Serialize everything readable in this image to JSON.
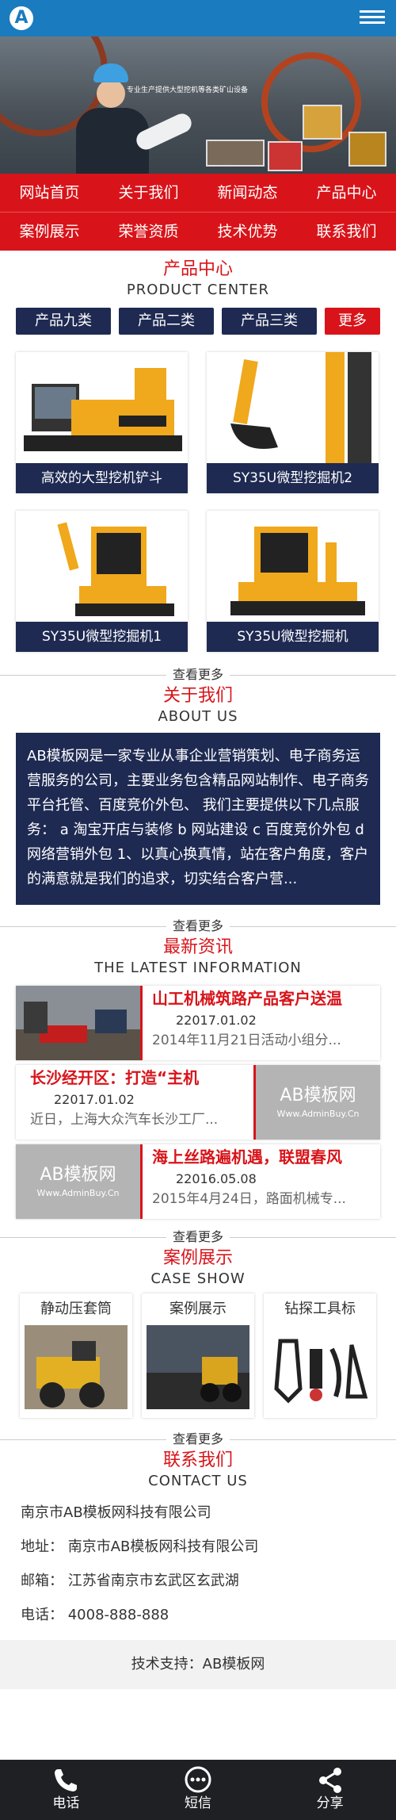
{
  "header": {
    "logo_letter": "A",
    "menu_icon": "hamburger-menu-icon"
  },
  "banner": {
    "tagline": "专业生产提供大型挖机等各类矿山设备"
  },
  "nav": {
    "row1": [
      "网站首页",
      "关于我们",
      "新闻动态",
      "产品中心"
    ],
    "row2": [
      "案例展示",
      "荣誉资质",
      "技术优势",
      "联系我们"
    ]
  },
  "products": {
    "title_cn": "产品中心",
    "title_en": "PRODUCT CENTER",
    "tabs": [
      "产品九类",
      "产品二类",
      "产品三类"
    ],
    "more_tab": "更多",
    "items": [
      "高效的大型挖机铲斗",
      "SY35U微型挖掘机2",
      "SY35U微型挖掘机1",
      "SY35U微型挖掘机"
    ],
    "more_link": "查看更多"
  },
  "about": {
    "title_cn": "关于我们",
    "title_en": "ABOUT US",
    "text": "AB模板网是一家专业从事企业营销策划、电子商务运营服务的公司，主要业务包含精品网站制作、电子商务平台托管、百度竞价外包、 我们主要提供以下几点服务： a 淘宝开店与装修 b 网站建设 c 百度竞价外包 d 网络营销外包 1、以真心换真情，站在客户角度，客户的满意就是我们的追求，切实结合客户营...",
    "more_link": "查看更多"
  },
  "news": {
    "title_cn": "最新资讯",
    "title_en": "THE LATEST INFORMATION",
    "items": [
      {
        "title": "山工机械筑路产品客户送温",
        "date": "22017.01.02",
        "summary": "2014年11月21日活动小组分..."
      },
      {
        "title": "长沙经开区：打造“主机",
        "date": "22017.01.02",
        "summary": "近日，上海大众汽车长沙工厂..."
      },
      {
        "title": "海上丝路遍机遇，联盟春风",
        "date": "22016.05.08",
        "summary": "2015年4月24日，路面机械专..."
      }
    ],
    "placeholder_logo": "AB模板网",
    "placeholder_url": "Www.AdminBuy.Cn",
    "more_link": "查看更多"
  },
  "cases": {
    "title_cn": "案例展示",
    "title_en": "CASE SHOW",
    "items": [
      "静动压套筒",
      "案例展示",
      "钻探工具标"
    ],
    "more_link": "查看更多"
  },
  "contact": {
    "title_cn": "联系我们",
    "title_en": "CONTACT US",
    "company": "南京市AB模板网科技有限公司",
    "address": "地址：  南京市AB模板网科技有限公司",
    "email": "邮箱：  江苏省南京市玄武区玄武湖",
    "phone": "电话：  4008-888-888"
  },
  "support": "技术支持：AB模板网",
  "footer": {
    "items": [
      "电话",
      "短信",
      "分享"
    ]
  },
  "colors": {
    "header": "#1a7bbf",
    "red": "#d8141a",
    "navy": "#1e2a52",
    "footer": "#1f2024"
  }
}
